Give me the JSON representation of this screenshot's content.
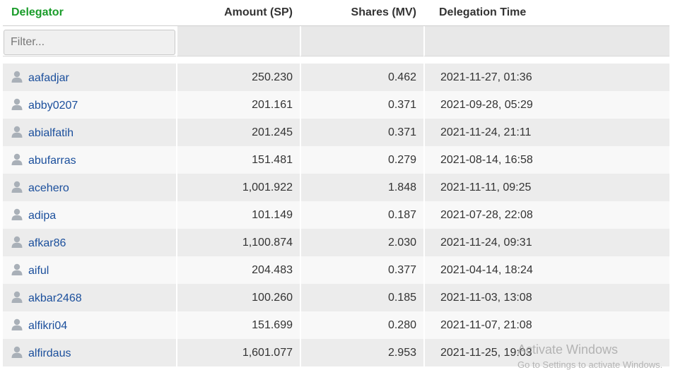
{
  "headers": {
    "delegator": "Delegator",
    "amount": "Amount (SP)",
    "shares": "Shares (MV)",
    "time": "Delegation Time"
  },
  "filter": {
    "placeholder": "Filter..."
  },
  "rows": [
    {
      "user": "aafadjar",
      "amount": "250.230",
      "shares": "0.462",
      "time": "2021-11-27, 01:36"
    },
    {
      "user": "abby0207",
      "amount": "201.161",
      "shares": "0.371",
      "time": "2021-09-28, 05:29"
    },
    {
      "user": "abialfatih",
      "amount": "201.245",
      "shares": "0.371",
      "time": "2021-11-24, 21:11"
    },
    {
      "user": "abufarras",
      "amount": "151.481",
      "shares": "0.279",
      "time": "2021-08-14, 16:58"
    },
    {
      "user": "acehero",
      "amount": "1,001.922",
      "shares": "1.848",
      "time": "2021-11-11, 09:25"
    },
    {
      "user": "adipa",
      "amount": "101.149",
      "shares": "0.187",
      "time": "2021-07-28, 22:08"
    },
    {
      "user": "afkar86",
      "amount": "1,100.874",
      "shares": "2.030",
      "time": "2021-11-24, 09:31"
    },
    {
      "user": "aiful",
      "amount": "204.483",
      "shares": "0.377",
      "time": "2021-04-14, 18:24"
    },
    {
      "user": "akbar2468",
      "amount": "100.260",
      "shares": "0.185",
      "time": "2021-11-03, 13:08"
    },
    {
      "user": "alfikri04",
      "amount": "151.699",
      "shares": "0.280",
      "time": "2021-11-07, 21:08"
    },
    {
      "user": "alfirdaus",
      "amount": "1,601.077",
      "shares": "2.953",
      "time": "2021-11-25, 19:03"
    }
  ],
  "watermark": {
    "title": "Activate Windows",
    "subtitle": "Go to Settings to activate Windows."
  },
  "colors": {
    "delegator_header": "#1a9c2a",
    "link": "#1b4f9c",
    "row_even": "#ececec",
    "row_odd": "#f8f8f8",
    "user_icon": "#a9b0b8"
  },
  "icons": {
    "user": "user-silhouette-icon"
  }
}
